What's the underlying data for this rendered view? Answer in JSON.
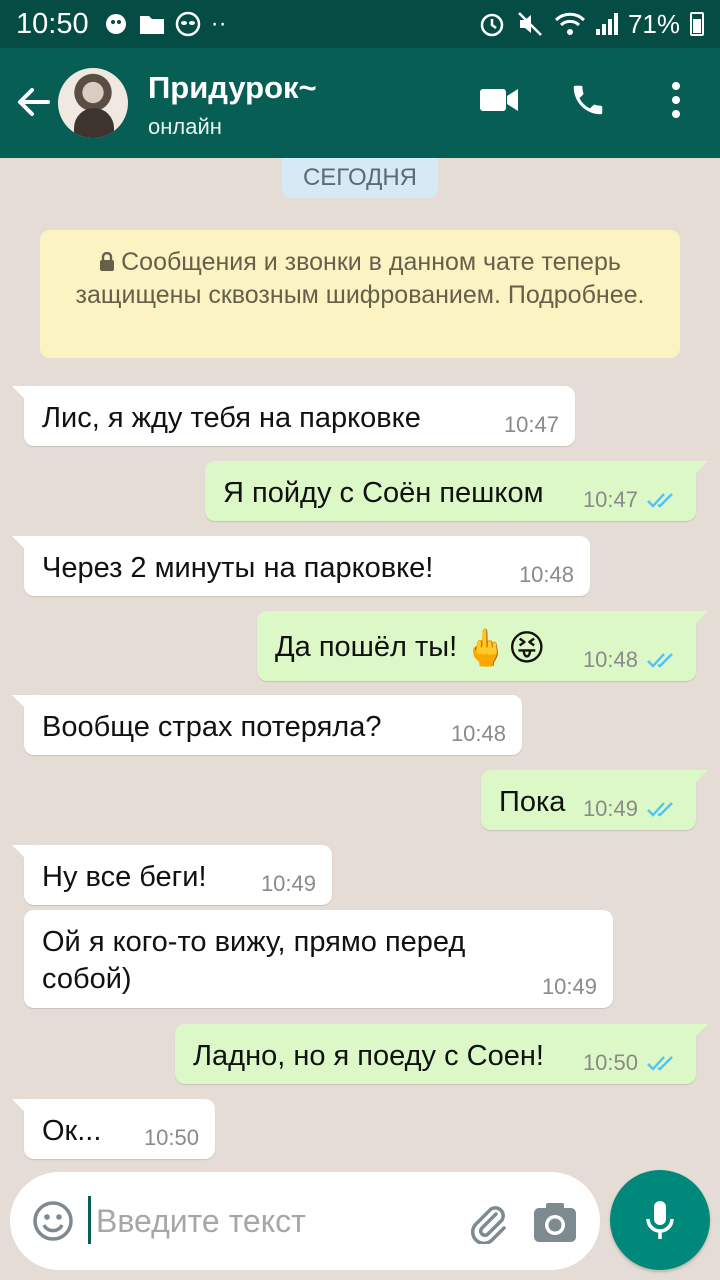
{
  "status_bar": {
    "time": "10:50",
    "battery": "71%",
    "dots": "··"
  },
  "header": {
    "contact_name": "Придурок~",
    "contact_status": "онлайн"
  },
  "chat": {
    "date_label": "СЕГОДНЯ",
    "encryption_notice": "Сообщения и звонки в данном чате теперь защищены сквозным шифрованием. Подробнее.",
    "messages": [
      {
        "dir": "in",
        "text": "Лис, я жду тебя на парковке",
        "time": "10:47"
      },
      {
        "dir": "out",
        "text": "Я пойду с Соён пешком",
        "time": "10:47"
      },
      {
        "dir": "in",
        "text": "Через 2 минуты на парковке!",
        "time": "10:48"
      },
      {
        "dir": "out",
        "text": "Да пошёл ты!",
        "emoji": "🖕😝",
        "time": "10:48"
      },
      {
        "dir": "in",
        "text": "Вообще страх потеряла?",
        "time": "10:48"
      },
      {
        "dir": "out",
        "text": "Пока",
        "time": "10:49"
      },
      {
        "dir": "in",
        "text": "Ну все беги!",
        "time": "10:49"
      },
      {
        "dir": "in",
        "text": "Ой я кого-то вижу, прямо перед собой)",
        "text_lines": [
          "Ой я кого-то вижу, прямо перед",
          "собой)"
        ],
        "time": "10:49"
      },
      {
        "dir": "out",
        "text": "Ладно, но я поеду с Соен!",
        "time": "10:50"
      },
      {
        "dir": "in",
        "text": "Ок...",
        "time": "10:50"
      }
    ]
  },
  "input": {
    "placeholder": "Введите текст",
    "value": ""
  },
  "colors": {
    "status_bar": "#054d44",
    "app_bar": "#075e54",
    "chat_bg": "#e5ddd5",
    "bubble_out": "#dcf8c6",
    "bubble_in": "#ffffff",
    "read_ticks": "#4fc3f7",
    "mic_button": "#00897b"
  },
  "icons": {
    "header": [
      "back-arrow-icon",
      "video-call-icon",
      "phone-icon",
      "more-vert-icon"
    ],
    "input": [
      "emoji-icon",
      "attach-icon",
      "camera-icon",
      "mic-icon"
    ]
  }
}
